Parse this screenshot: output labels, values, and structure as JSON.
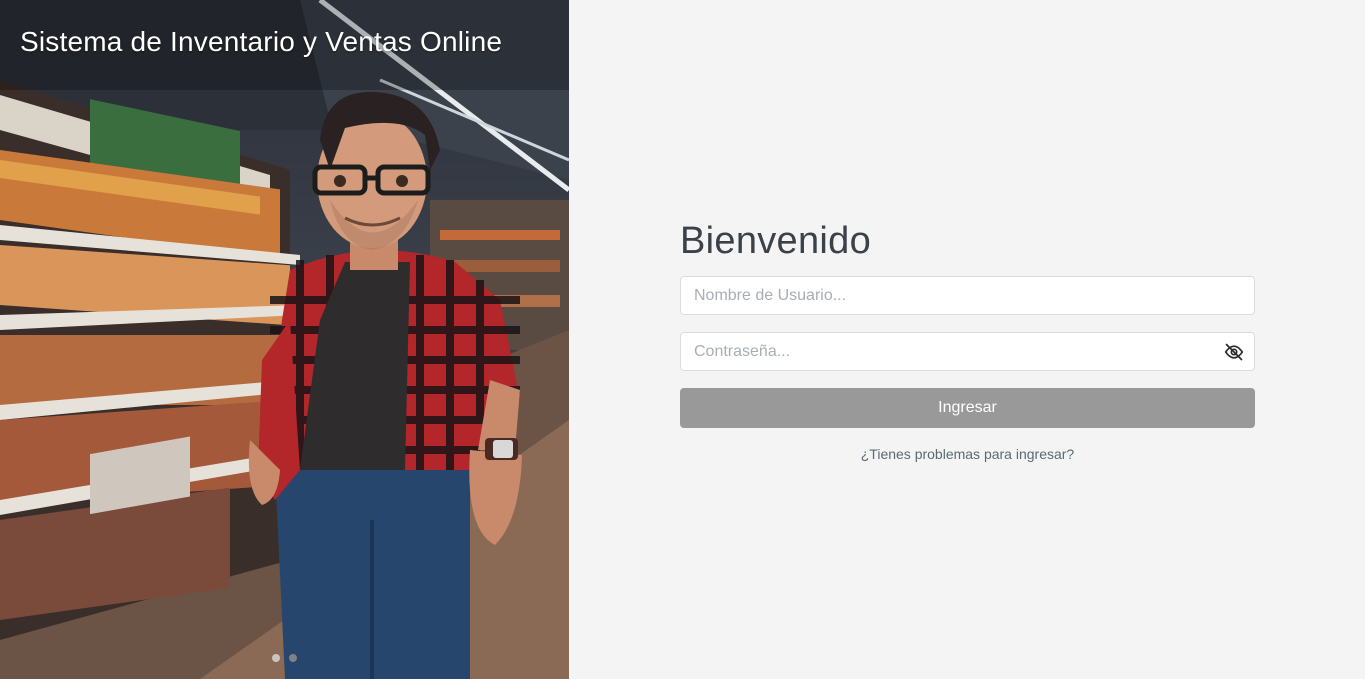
{
  "hero": {
    "title": "Sistema de Inventario y Ventas Online",
    "slides_total": 2,
    "active_slide": 1
  },
  "login": {
    "heading": "Bienvenido",
    "username_placeholder": "Nombre de Usuario...",
    "username_value": "",
    "password_placeholder": "Contraseña...",
    "password_value": "",
    "submit_label": "Ingresar",
    "help_link": "¿Tienes problemas para ingresar?"
  },
  "icons": {
    "password_toggle": "eye-off-icon"
  },
  "colors": {
    "page_bg": "#f4f4f4",
    "button_bg": "#999999",
    "heading": "#3a4149",
    "link": "#5a6a75"
  }
}
